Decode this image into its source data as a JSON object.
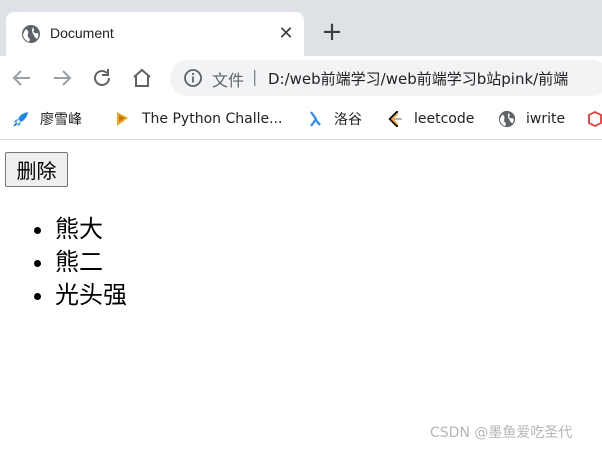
{
  "browser": {
    "tab": {
      "title": "Document"
    },
    "address_bar": {
      "scheme_label": "文件",
      "separator": "|",
      "url": "D:/web前端学习/web前端学习b站pink/前端"
    },
    "bookmarks": [
      {
        "label": "廖雪峰",
        "icon": "rocket-icon"
      },
      {
        "label": "The Python Challe...",
        "icon": "python-challenge-icon"
      },
      {
        "label": "洛谷",
        "icon": "luogu-icon"
      },
      {
        "label": "leetcode",
        "icon": "leetcode-icon"
      },
      {
        "label": "iwrite",
        "icon": "globe-icon"
      }
    ]
  },
  "page": {
    "delete_button_label": "删除",
    "list_items": [
      "熊大",
      "熊二",
      "光头强"
    ],
    "watermark": "CSDN @墨鱼爱吃圣代"
  },
  "colors": {
    "tabstrip_bg": "#dee1e6",
    "omnibox_bg": "#f1f3f4",
    "leetcode_orange": "#ffa116",
    "luogu_blue": "#2d8cf0"
  }
}
